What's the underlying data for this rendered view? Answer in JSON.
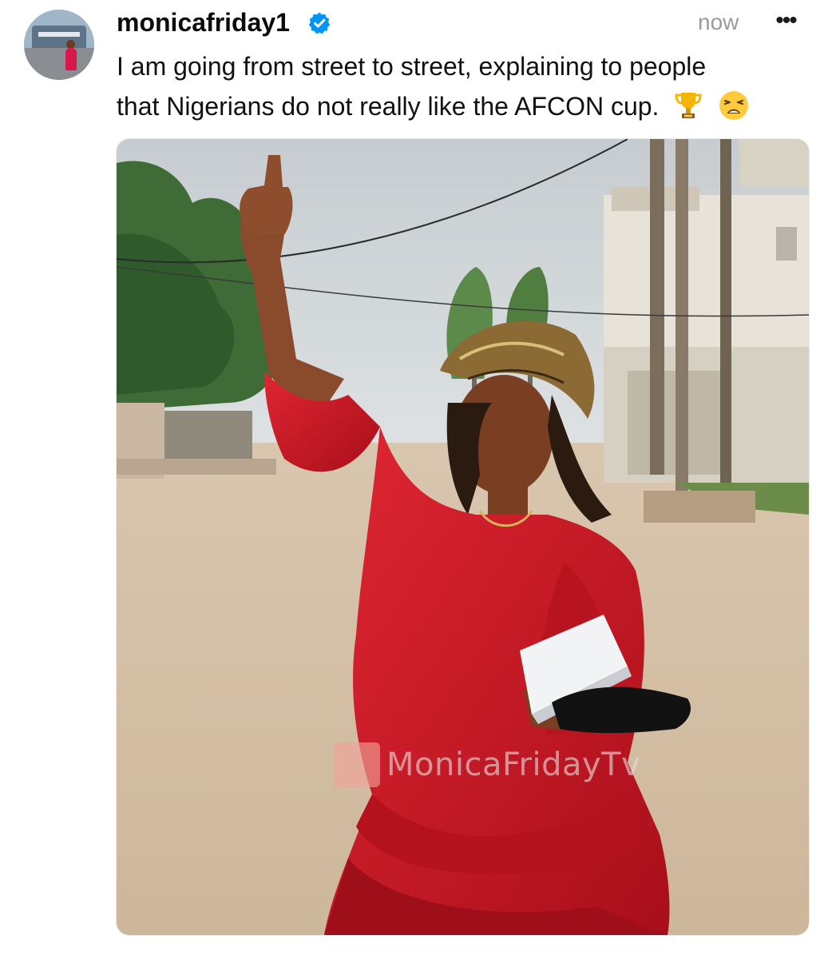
{
  "post": {
    "username": "monicafriday1",
    "verified": true,
    "timestamp": "now",
    "more_label": "•••",
    "caption_line1": "I am going from street to street, explaining to people",
    "caption_line2": "that Nigerians do not really like the AFCON cup.",
    "caption_emojis": [
      "trophy-emoji",
      "weary-face-emoji"
    ],
    "media": {
      "watermark": "MonicaFridayTv"
    }
  },
  "colors": {
    "verified_badge": "#0095f6",
    "dress": "#c41420",
    "timestamp": "#9a9a9a"
  }
}
